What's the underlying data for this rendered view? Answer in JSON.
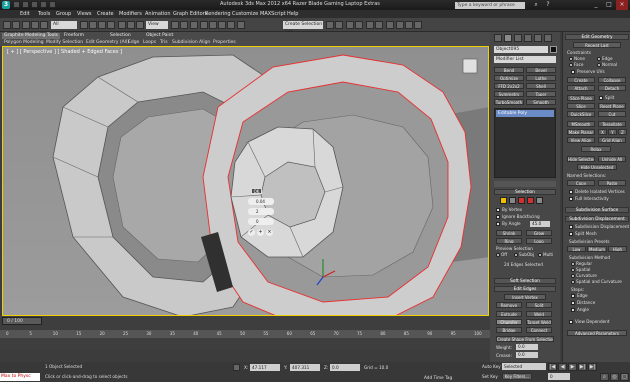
{
  "window": {
    "title": "Autodesk 3ds Max 2012 x64    Razer Blade Gaming Laptop Extras",
    "search_placeholder": "Type a keyword or phrase",
    "logo": "3ds-max-logo"
  },
  "menus": [
    "Edit",
    "Tools",
    "Group",
    "Views",
    "Create",
    "Modifiers",
    "Animation",
    "Graph Editors",
    "Rendering",
    "Customize",
    "MAXScript",
    "Help"
  ],
  "toolbar": {
    "selection_filter": "All",
    "view_dropdown": "View",
    "selection_set": "Create Selection Set"
  },
  "ribbon": {
    "tabs": [
      "Graphite Modeling Tools",
      "Freeform",
      "Selection",
      "Object Paint"
    ],
    "subtabs": [
      "Polygon Modeling",
      "Modify Selection",
      "Edit",
      "Geometry (All)",
      "Edge",
      "Loops",
      "Tris",
      "Subdivision",
      "Align",
      "Properties"
    ]
  },
  "viewport": {
    "label": "[ + ] [ Perspective ] [ Shaded + Edged Faces ]",
    "caddy": {
      "ok": "OK",
      "field1": "0.04",
      "field2": "2",
      "field3": "0"
    }
  },
  "command_panel": {
    "object_name": "Object095",
    "modifier_list": "Modifier List",
    "modifier_buttons": [
      "Bend",
      "Bevel",
      "Optimize",
      "Lathe",
      "FFD 2x2x2",
      "Shell",
      "Symmetry",
      "Taper",
      "TurboSmooth",
      "Smooth"
    ],
    "stack_item": "Editable Poly",
    "selection": {
      "header": "Selection",
      "by_vertex": "By Vertex",
      "ignore_backfacing": "Ignore Backfacing",
      "by_angle": "By Angle",
      "angle_value": "45.0",
      "shrink": "Shrink",
      "grow": "Grow",
      "ring": "Ring",
      "loop": "Loop",
      "preview_selection": "Preview Selection",
      "off": "Off",
      "subobj": "SubObj",
      "multi": "Multi",
      "status": "24 Edges Selected"
    },
    "soft_selection": "Soft Selection",
    "edit_edges": {
      "header": "Edit Edges",
      "insert_vertex": "Insert Vertex",
      "remove": "Remove",
      "split": "Split",
      "extrude": "Extrude",
      "weld": "Weld",
      "chamfer": "Chamfer",
      "target_weld": "Target Weld",
      "bridge": "Bridge",
      "connect": "Connect",
      "create_shape": "Create Shape From Selection",
      "weight": "Weight:",
      "weight_value": "0.0",
      "crease": "Crease:",
      "crease_value": "0.0"
    }
  },
  "edit_geometry": {
    "header": "Edit Geometry",
    "repeat_last": "Repeat Last",
    "constraints": "Constraints",
    "none": "None",
    "edge": "Edge",
    "face": "Face",
    "normal": "Normal",
    "preserve_uvs": "Preserve UVs",
    "create": "Create",
    "collapse": "Collapse",
    "attach": "Attach",
    "detach": "Detach",
    "slice_plane": "Slice Plane",
    "split": "Split",
    "slice": "Slice",
    "reset_plane": "Reset Plane",
    "quickslice": "QuickSlice",
    "cut": "Cut",
    "msmooth": "MSmooth",
    "tessellate": "Tessellate",
    "make_planar": "Make Planar",
    "x": "X",
    "y": "Y",
    "z": "Z",
    "view_align": "View Align",
    "grid_align": "Grid Align",
    "relax": "Relax",
    "hide_selected": "Hide Selected",
    "unhide_all": "Unhide All",
    "hide_unselected": "Hide Unselected",
    "named_selections": "Named Selections:",
    "copy": "Copy",
    "paste": "Paste",
    "delete_isolated": "Delete Isolated Vertices",
    "full_interactivity": "Full Interactivity",
    "subdivision_surface": "Subdivision Surface",
    "subdivision_displacement": "Subdivision Displacement",
    "subdiv_displacement_chk": "Subdivision Displacement",
    "split_mesh": "Split Mesh",
    "subdivision_presets": "Subdivision Presets",
    "low": "Low",
    "medium": "Medium",
    "high": "High",
    "subdivision_method": "Subdivision Method",
    "regular": "Regular",
    "spatial": "Spatial",
    "curvature": "Curvature",
    "spatial_curvature": "Spatial and Curvature",
    "steps": "Steps:",
    "edge_lbl": "Edge",
    "distance": "Distance",
    "angle": "Angle",
    "view_dependent": "View Dependent",
    "advanced_params": "Advanced Parameters"
  },
  "timeline": {
    "slider": "0 / 100",
    "ticks": [
      "0",
      "5",
      "10",
      "15",
      "20",
      "25",
      "30",
      "35",
      "40",
      "45",
      "50",
      "55",
      "60",
      "65",
      "70",
      "75",
      "80",
      "85",
      "90",
      "95",
      "100"
    ]
  },
  "status": {
    "maxscript": "Max to Physc",
    "selection": "1 Object Selected",
    "prompt": "Click or click-and-drag to select objects",
    "x_label": "X:",
    "x_value": "47.117",
    "y_label": "Y:",
    "y_value": "407.311",
    "z_label": "Z:",
    "z_value": "0.0",
    "grid": "Grid = 10.0",
    "add_time_tag": "Add Time Tag",
    "auto_key": "Auto Key",
    "selected": "Selected",
    "set_key": "Set Key",
    "key_filters": "Key Filters...",
    "frame": "0"
  },
  "colors": {
    "viewport_bg": "#959595",
    "selected_edge": "#e83030",
    "accent": "#f0d000"
  }
}
